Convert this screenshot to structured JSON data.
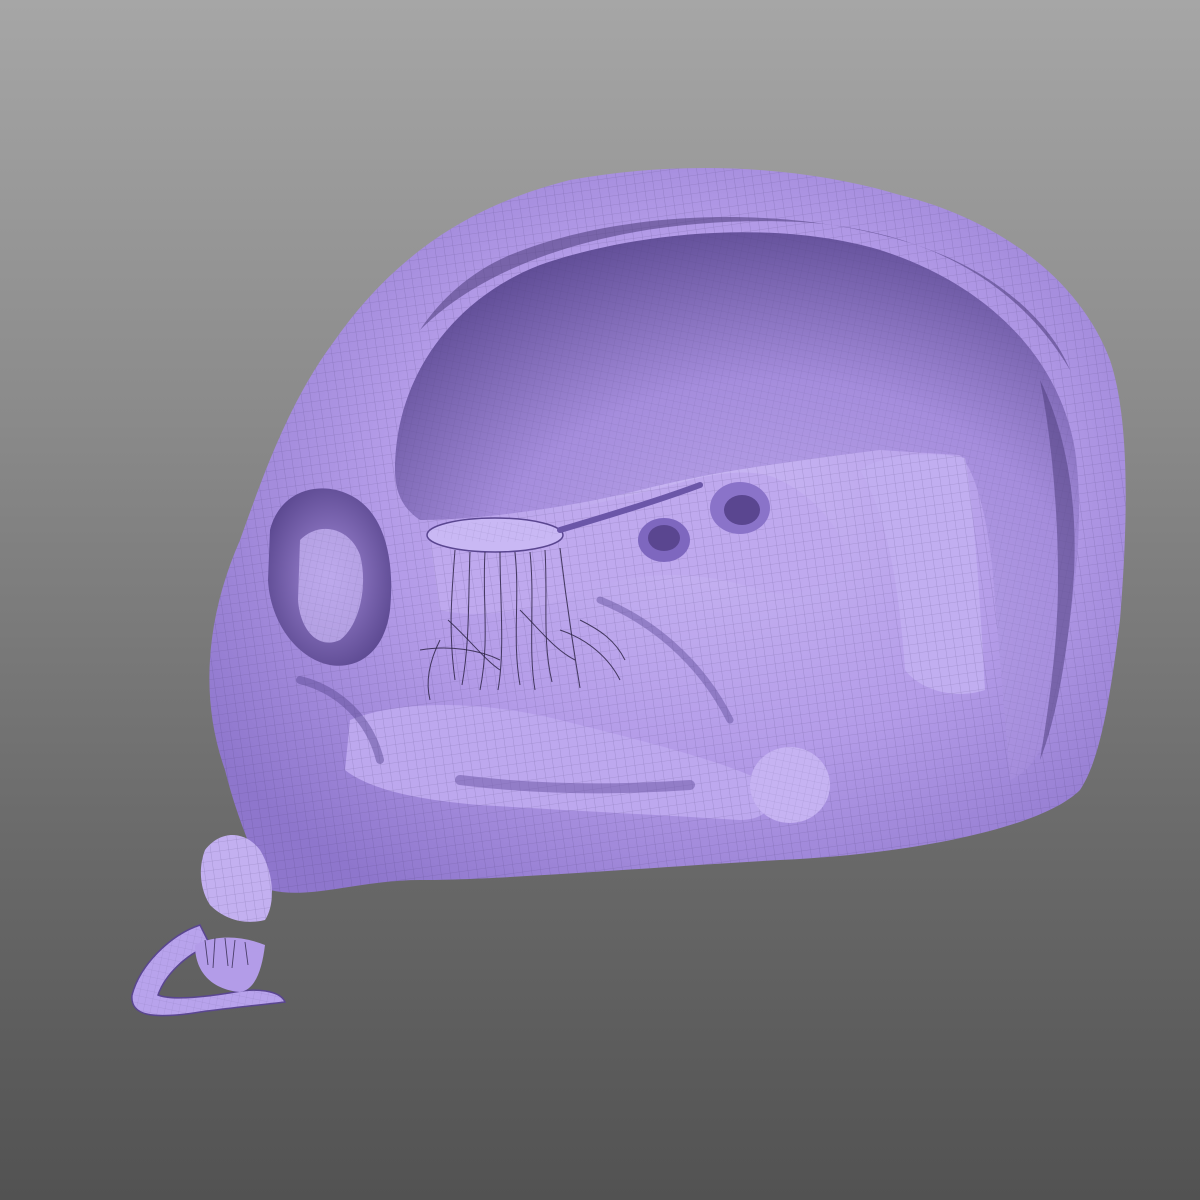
{
  "viewport": {
    "background_top": "#a6a6a6",
    "background_bottom": "#525252"
  },
  "model": {
    "surface_color": "#b49ce8",
    "shade_color": "#6f5aa8",
    "highlight_color": "#d6c8f6",
    "wire_color": "#3d3160",
    "display_mode": "wireframe-on-shaded",
    "icon": "sculpt-mesh-icon"
  }
}
